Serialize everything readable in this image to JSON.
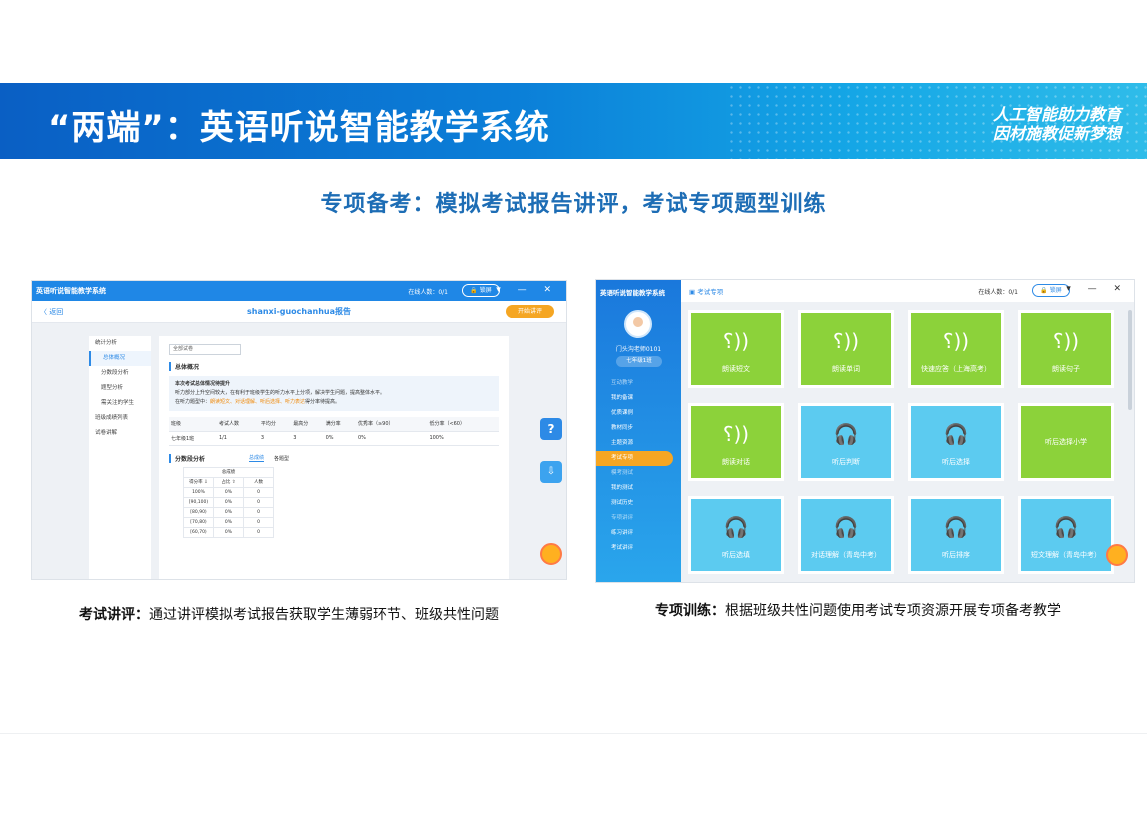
{
  "banner": {
    "title": "“两端”：英语听说智能教学系统",
    "slogan_line1": "人工智能助力教育",
    "slogan_line2": "因材施教促新梦想"
  },
  "subtitle": "专项备考：模拟考试报告讲评，考试专项题型训练",
  "left_screenshot": {
    "app_title": "英语听说智能教学系统",
    "online": "在线人数：0/1",
    "lock_label": "锁屏",
    "window_controls": "▾ — ✕",
    "back_label": "〈 返回",
    "report_title": "shanxi-guochanhua报告",
    "open_button": "开始讲评",
    "sidebar": [
      "统计分析",
      "总体概况",
      "分数段分析",
      "题型分析",
      "需关注的学生",
      "班级成绩列表",
      "试卷讲解"
    ],
    "filter": "全部试卷",
    "overview_heading": "总体概况",
    "overview_lines": [
      "本次考试总体情况待提升",
      "听力部分上升空间较大，在有利于班级学生的听力水平上分项，解决学生问题，提高整体水平。",
      "在听力题型中："
    ],
    "overview_highlights": [
      "朗读短文、对话理解、听后选择、听力表达"
    ],
    "overview_tail": "得分率待提高。",
    "stats_headers": [
      "班级",
      "考试人数",
      "平均分",
      "最高分",
      "满分率",
      "优秀率（≥90）",
      "低分率（<60）"
    ],
    "stats_row": [
      "七年级1班",
      "1/1",
      "3",
      "3",
      "0%",
      "0%",
      "100%"
    ],
    "dist_heading": "分数段分析",
    "dist_tabs": [
      "总成绩",
      "各题型"
    ],
    "dist_group": "总成绩",
    "dist_headers": [
      "得分率 ⇩",
      "占比 ⇧",
      "人数"
    ],
    "dist_rows": [
      [
        "100%",
        "0%",
        "0"
      ],
      [
        "[90,100)",
        "0%",
        "0"
      ],
      [
        "[80,90)",
        "0%",
        "0"
      ],
      [
        "[70,80)",
        "0%",
        "0"
      ],
      [
        "[60,70)",
        "0%",
        "0"
      ]
    ],
    "help_label": "?",
    "download_label": "⇩"
  },
  "right_screenshot": {
    "app_title": "英语听说智能教学系统",
    "breadcrumb": "考试专项",
    "online": "在线人数：0/1",
    "lock_label": "锁屏",
    "window_controls": "▾ — ✕",
    "teacher_name": "门头沟老师0101",
    "class_name": "七年级1班",
    "menu": [
      {
        "label": "互动教学",
        "group": true
      },
      {
        "label": "我的备课"
      },
      {
        "label": "优质课例"
      },
      {
        "label": "教材同步"
      },
      {
        "label": "主题资源"
      },
      {
        "label": "考试专项",
        "active": true
      },
      {
        "label": "模考测试",
        "group": true
      },
      {
        "label": "我的测试"
      },
      {
        "label": "测试历史"
      },
      {
        "label": "专项讲评",
        "group": true
      },
      {
        "label": "练习讲评"
      },
      {
        "label": "考试讲评"
      }
    ],
    "tiles": [
      {
        "label": "朗读短文",
        "color": "#8cd23a",
        "icon": "speak-icon"
      },
      {
        "label": "朗读单词",
        "color": "#8cd23a",
        "icon": "speak-icon"
      },
      {
        "label": "快速应答（上海高考）",
        "color": "#8cd23a",
        "icon": "speak-icon"
      },
      {
        "label": "朗读句子",
        "color": "#8cd23a",
        "icon": "speak-icon"
      },
      {
        "label": "朗读对话",
        "color": "#8cd23a",
        "icon": "speak-icon"
      },
      {
        "label": "听后判断",
        "color": "#5ccbf0",
        "icon": "headphone-icon"
      },
      {
        "label": "听后选择",
        "color": "#5ccbf0",
        "icon": "headphone-icon"
      },
      {
        "label": "听后选择小学",
        "color": "#8cd23a",
        "icon": ""
      },
      {
        "label": "听后选填",
        "color": "#5ccbf0",
        "icon": "headphone-icon"
      },
      {
        "label": "对话理解（青岛中考）",
        "color": "#5ccbf0",
        "icon": "headphone-icon"
      },
      {
        "label": "听后排序",
        "color": "#5ccbf0",
        "icon": "headphone-icon"
      },
      {
        "label": "短文理解（青岛中考）",
        "color": "#5ccbf0",
        "icon": "headphone-icon"
      }
    ]
  },
  "captions": {
    "left_bold": "考试讲评：",
    "left_text": "通过讲评模拟考试报告获取学生薄弱环节、班级共性问题",
    "right_bold": "专项训练：",
    "right_text": "根据班级共性问题使用考试专项资源开展专项备考教学"
  },
  "colors": {
    "banner_start": "#0a5fc4",
    "banner_end": "#2fbce9",
    "subtitle": "#1d6db5",
    "tile_green": "#8cd23a",
    "tile_blue": "#5ccbf0",
    "accent_orange": "#f6a623"
  }
}
